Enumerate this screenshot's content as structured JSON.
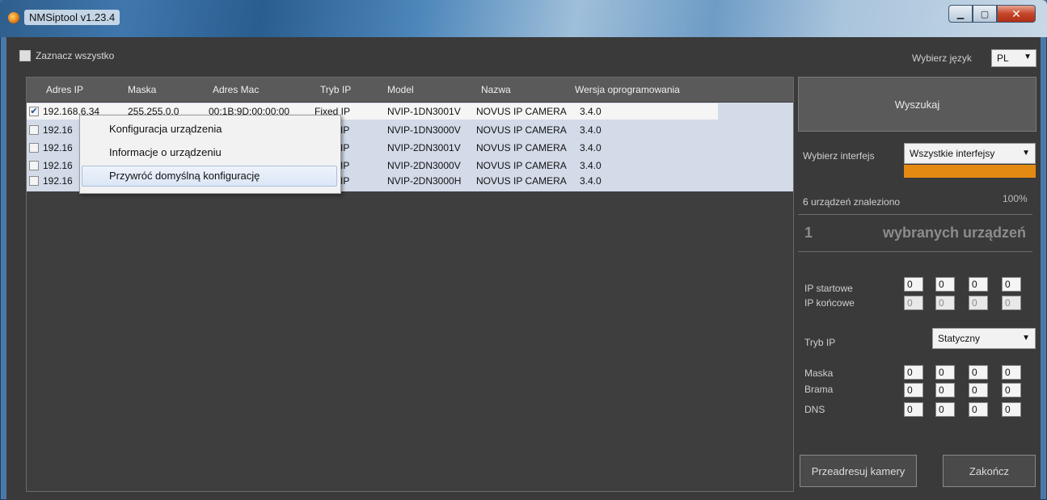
{
  "window": {
    "title": "NMSiptool v1.23.4"
  },
  "select_all": {
    "label": "Zaznacz wszystko"
  },
  "language": {
    "label": "Wybierz język",
    "value": "PL"
  },
  "table": {
    "columns": [
      "Adres IP",
      "Maska",
      "Adres Mac",
      "Tryb IP",
      "Model",
      "Nazwa",
      "Wersja oprogramowania"
    ],
    "rows": [
      {
        "checked": "✔",
        "ip": "192.168.6.34",
        "mask": "255.255.0.0",
        "mac": "00:1B:9D:00:00:00",
        "mode": "Fixed IP",
        "model": "NVIP-1DN3001V",
        "name": "NOVUS IP CAMERA",
        "version": "3.4.0"
      },
      {
        "checked": "",
        "ip": "192.16",
        "mode": "d IP",
        "model": "NVIP-1DN3000V",
        "name": "NOVUS IP CAMERA",
        "version": "3.4.0"
      },
      {
        "checked": "",
        "ip": "192.16",
        "mode": "d IP",
        "model": "NVIP-2DN3001V",
        "name": "NOVUS IP CAMERA",
        "version": "3.4.0"
      },
      {
        "checked": "",
        "ip": "192.16",
        "mode": "d IP",
        "model": "NVIP-2DN3000V",
        "name": "NOVUS IP CAMERA",
        "version": "3.4.0"
      },
      {
        "checked": "",
        "ip": "192.16",
        "mode": "d IP",
        "model": "NVIP-2DN3000H",
        "name": "NOVUS IP CAMERA",
        "version": "3.4.0"
      }
    ]
  },
  "context_menu": {
    "items": [
      "Konfiguracja urządzenia",
      "Informacje o urządzeniu",
      "Przywróć domyślną konfigurację"
    ]
  },
  "panel": {
    "search_label": "Wyszukaj",
    "interface_label": "Wybierz interfejs",
    "interface_value": "Wszystkie interfejsy",
    "found_text": "6 urządzeń znaleziono",
    "progress_text": "100%",
    "progress_fraction": 1.0,
    "selected_count": "1",
    "selected_label": "wybranych urządzeń",
    "ip_start_label": "IP startowe",
    "ip_end_label": "IP końcowe",
    "ip_start": [
      "0",
      "0",
      "0",
      "0"
    ],
    "ip_end": [
      "0",
      "0",
      "0",
      "0"
    ],
    "mode_label": "Tryb IP",
    "mode_value": "Statyczny",
    "mask_label": "Maska",
    "gateway_label": "Brama",
    "dns_label": "DNS",
    "mask": [
      "0",
      "0",
      "0",
      "0"
    ],
    "gateway": [
      "0",
      "0",
      "0",
      "0"
    ],
    "dns": [
      "0",
      "0",
      "0",
      "0"
    ],
    "readdress_label": "Przeadresuj kamery",
    "finish_label": "Zakończ"
  },
  "colors": {
    "accent": "#e48a12",
    "panel_bg": "#3a3a3a",
    "row_bg": "#d3dbe9"
  }
}
